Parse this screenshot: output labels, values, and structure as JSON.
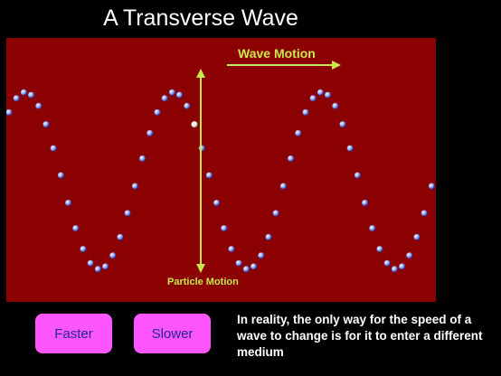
{
  "title": "A Transverse Wave",
  "stage": {
    "wave_motion_label": "Wave Motion",
    "particle_motion_label": "Particle Motion",
    "background_color": "#8b0000",
    "arrow_color": "#c6e84a",
    "particle_color": "#8fa3ff"
  },
  "buttons": {
    "faster_label": "Faster",
    "slower_label": "Slower"
  },
  "note": "In reality, the only way for the speed of a wave to change is for it to enter a different medium"
}
